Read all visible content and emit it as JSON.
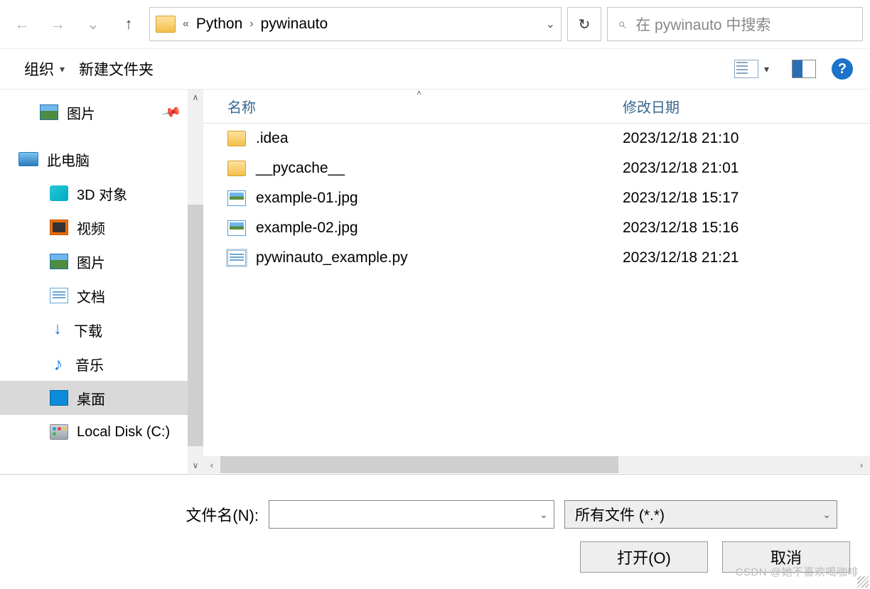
{
  "nav": {
    "back": "←",
    "forward": "→",
    "recent": "⌄",
    "up": "↑"
  },
  "address": {
    "segments": [
      "Python",
      "pywinauto"
    ],
    "sep_left": "«",
    "sep_mid": "›",
    "dropdown": "⌄",
    "refresh": "↻"
  },
  "search": {
    "placeholder": "在 pywinauto 中搜索"
  },
  "toolbar": {
    "organize": "组织",
    "new_folder": "新建文件夹",
    "help": "?"
  },
  "sidebar": {
    "items": [
      {
        "label": "图片",
        "icon": "pic",
        "indent": 1,
        "pinned": true
      },
      {
        "label": "此电脑",
        "icon": "pc",
        "indent": 0
      },
      {
        "label": "3D 对象",
        "icon": "3d",
        "indent": 2
      },
      {
        "label": "视频",
        "icon": "vid",
        "indent": 2
      },
      {
        "label": "图片",
        "icon": "pic",
        "indent": 2
      },
      {
        "label": "文档",
        "icon": "doc",
        "indent": 2
      },
      {
        "label": "下载",
        "icon": "dl",
        "indent": 2
      },
      {
        "label": "音乐",
        "icon": "mus",
        "indent": 2
      },
      {
        "label": "桌面",
        "icon": "dsk",
        "indent": 2,
        "selected": true
      },
      {
        "label": "Local Disk (C:)",
        "icon": "dsk-c",
        "indent": 2
      }
    ]
  },
  "columns": {
    "name": "名称",
    "modified": "修改日期"
  },
  "files": [
    {
      "name": ".idea",
      "date": "2023/12/18 21:10",
      "icon": "fld"
    },
    {
      "name": "__pycache__",
      "date": "2023/12/18 21:01",
      "icon": "fld"
    },
    {
      "name": "example-01.jpg",
      "date": "2023/12/18 15:17",
      "icon": "jpg"
    },
    {
      "name": "example-02.jpg",
      "date": "2023/12/18 15:16",
      "icon": "jpg"
    },
    {
      "name": "pywinauto_example.py",
      "date": "2023/12/18 21:21",
      "icon": "py"
    }
  ],
  "bottom": {
    "filename_label": "文件名(N):",
    "filename_value": "",
    "type_value": "所有文件 (*.*)",
    "open": "打开(O)",
    "cancel": "取消"
  },
  "watermark": "CSDN @她不喜欢喝咖啡"
}
